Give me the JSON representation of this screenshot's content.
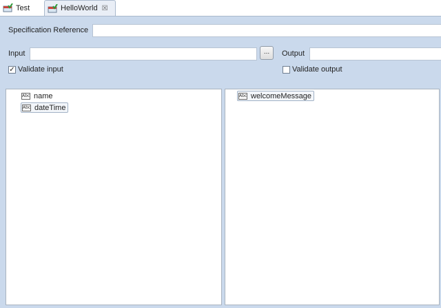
{
  "tabs": [
    {
      "label": "Test",
      "active": false
    },
    {
      "label": "HelloWorld",
      "active": true
    }
  ],
  "form": {
    "spec_ref_label": "Specification Reference",
    "spec_ref_value": "",
    "input_label": "Input",
    "input_value": "",
    "browse_label": "...",
    "output_label": "Output",
    "output_value": "",
    "validate_input_label": "Validate input",
    "validate_input_checked": true,
    "validate_output_label": "Validate output",
    "validate_output_checked": false
  },
  "left_pane": {
    "items": [
      {
        "label": "name",
        "icon": "abc-icon"
      },
      {
        "label": "dateTime",
        "icon": "abc-icon"
      }
    ]
  },
  "right_pane": {
    "items": [
      {
        "label": "welcomeMessage",
        "icon": "abc-icon"
      }
    ]
  },
  "colors": {
    "form_bg": "#cad9ec",
    "active_tab_bg": "#e9eef6",
    "border": "#a9b9cc"
  }
}
